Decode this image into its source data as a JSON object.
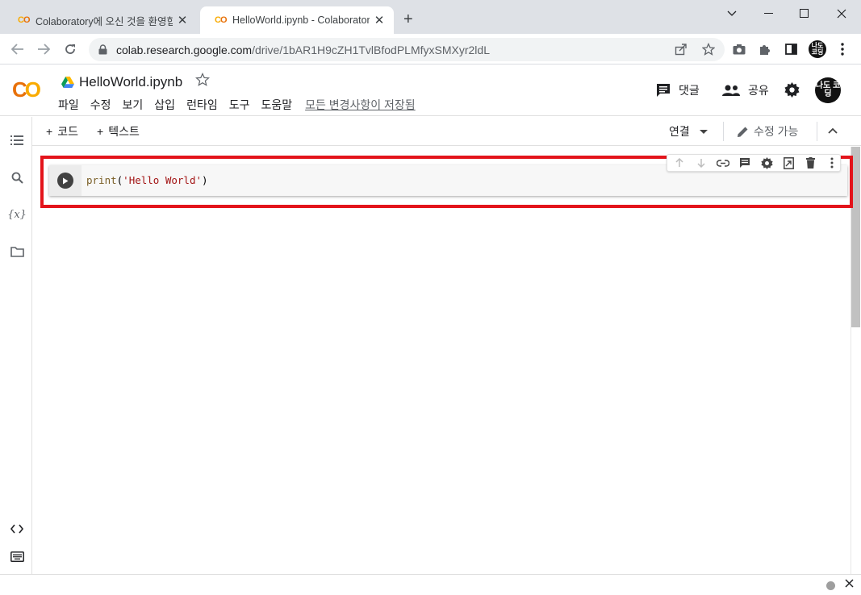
{
  "browser": {
    "tabs": [
      {
        "title": "Colaboratory에 오신 것을 환영합니다",
        "logo": "CO",
        "close": "✕",
        "active": false
      },
      {
        "title": "HelloWorld.ipynb - Colaboratory",
        "logo": "CO",
        "close": "✕",
        "active": true
      }
    ],
    "new_tab": "+",
    "window_controls": {
      "minimize": "—",
      "maximize": "☐",
      "close": "✕"
    },
    "url_host": "colab.research.google.com",
    "url_path": "/drive/1bAR1H9cZH1TvlBfodPLMfyxSMXyr2ldL",
    "profile_initials": "나도 코딩"
  },
  "colab": {
    "logo": "CO",
    "notebook_title": "HelloWorld.ipynb",
    "menu": [
      "파일",
      "수정",
      "보기",
      "삽입",
      "런타임",
      "도구",
      "도움말"
    ],
    "saved_status": "모든 변경사항이 저장됨",
    "comment_label": "댓글",
    "share_label": "공유",
    "avatar_initials": "나도 코딩"
  },
  "toolbar": {
    "add_code": "코드",
    "add_text": "텍스트",
    "connect": "연결",
    "edit_mode": "수정 가능"
  },
  "cell": {
    "code_func": "print",
    "code_open": "(",
    "code_string": "'Hello World'",
    "code_close": ")"
  },
  "colors": {
    "highlight": "#e3141b",
    "colab_orange": "#e8710a",
    "colab_yellow": "#f9ab00"
  }
}
